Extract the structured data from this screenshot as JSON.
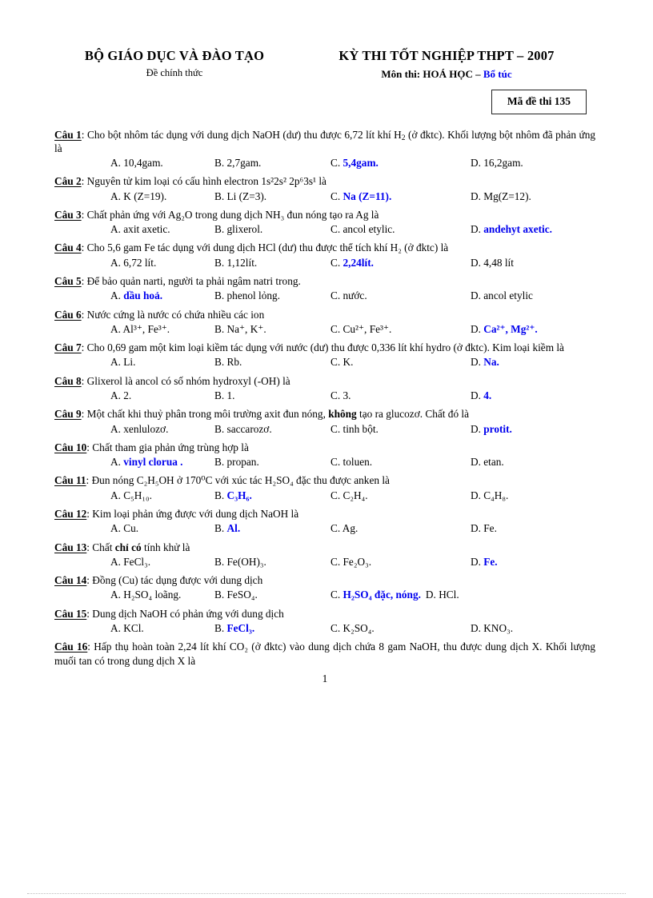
{
  "header": {
    "ministry": "BỘ GIÁO DỤC VÀ ĐÀO TẠO",
    "official": "Đề chính thức",
    "exam_title": "KỲ THI  TỐT NGHIỆP THPT – 2007",
    "subject_label": "Môn thi:  HOÁ HỌC – ",
    "subject_suffix": "Bổ túc",
    "code_box": "Mã đề thi 135",
    "accent_color": "#0000ee"
  },
  "questions": [
    {
      "label": "Câu 1",
      "stem_pre": ": Cho bột nhôm  tác dụng  với  dung  dịch  NaOH (dư) thu được 6,72 lít  khí H",
      "stem_sub": "2",
      "stem_post": " (ở đktc). Khối lượng bột nhôm  đã phản ứng là",
      "layout": "default",
      "options": [
        {
          "letter": "A.",
          "text": "10,4gam.",
          "correct": false
        },
        {
          "letter": "B.",
          "text": "2,7gam.",
          "correct": false
        },
        {
          "letter": "C.",
          "text": "5,4gam.",
          "correct": true
        },
        {
          "letter": "D.",
          "text": "16,2gam.",
          "correct": false
        }
      ]
    },
    {
      "label": "Câu 2",
      "stem_text": ": Nguyên  tử kim  loại  có cấu hình  electron  1s²2s² 2p⁶3s¹ là",
      "layout": "default",
      "options": [
        {
          "letter": "A.",
          "text": "K (Z=19).",
          "correct": false
        },
        {
          "letter": "B.",
          "text": "Li (Z=3).",
          "correct": false
        },
        {
          "letter": "C.",
          "text": "Na (Z=11).",
          "correct": true
        },
        {
          "letter": "D.",
          "text": "Mg(Z=12).",
          "correct": false
        }
      ]
    },
    {
      "label": "Câu 3",
      "stem_text": ": Chất phản ứng với Ag₂O trong  dung  dịch NH₃ đun nóng  tạo ra Ag là",
      "layout": "default",
      "options": [
        {
          "letter": "A.",
          "text": "axit  axetic.",
          "correct": false
        },
        {
          "letter": "B.",
          "text": "glixerol.",
          "correct": false
        },
        {
          "letter": "C.",
          "text": "ancol etylic.",
          "correct": false
        },
        {
          "letter": "D.",
          "text": "andehyt  axetic.",
          "correct": true
        }
      ]
    },
    {
      "label": "Câu 4",
      "stem_text": ": Cho 5,6 gam Fe tác dụng  với  dung  dịch HCl  (dư) thu  được thể  tích  khí H₂ (ở đktc) là",
      "layout": "default",
      "options": [
        {
          "letter": "A.",
          "text": "6,72 lít.",
          "correct": false
        },
        {
          "letter": "B.",
          "text": "1,12lít.",
          "correct": false
        },
        {
          "letter": "C.",
          "text": "2,24lít.",
          "correct": true
        },
        {
          "letter": "D.",
          "text": "4,48 lít",
          "correct": false
        }
      ]
    },
    {
      "label": "Câu 5",
      "stem_text": ": Để bảo quản narti, người  ta phải  ngâm  natri  trong.",
      "layout": "default",
      "options": [
        {
          "letter": "A.",
          "text": "dầu hoả.",
          "correct": true
        },
        {
          "letter": "B.",
          "text": "phenol lỏng.",
          "correct": false
        },
        {
          "letter": "C.",
          "text": "nước.",
          "correct": false
        },
        {
          "letter": "D.",
          "text": "ancol etylic",
          "correct": false
        }
      ]
    },
    {
      "label": "Câu 6",
      "stem_text": ": Nước cứng là nước có chứa nhiều  các ion",
      "layout": "default",
      "options": [
        {
          "letter": "A.",
          "text": "Al³⁺, Fe³⁺.",
          "correct": false
        },
        {
          "letter": "B.",
          "text": "Na⁺, K⁺.",
          "correct": false
        },
        {
          "letter": "C.",
          "text": "Cu²⁺, Fe³⁺.",
          "correct": false
        },
        {
          "letter": "D.",
          "text": "Ca²⁺, Mg²⁺.",
          "correct": true
        }
      ]
    },
    {
      "label": "Câu 7",
      "stem_text": ": Cho 0,69 gam  một kim  loại  kiềm  tác dụng  với  nước  (dư) thu  được 0,336 lít  khí hydro  (ở đktc). Kim  loại kiềm là",
      "layout": "default",
      "options": [
        {
          "letter": "A.",
          "text": "Li.",
          "correct": false
        },
        {
          "letter": "B.",
          "text": "Rb.",
          "correct": false
        },
        {
          "letter": "C.",
          "text": "K.",
          "correct": false
        },
        {
          "letter": "D.",
          "text": "Na.",
          "correct": true
        }
      ]
    },
    {
      "label": "Câu 8",
      "stem_text": ": Glixerol  là ancol có số nhóm  hydroxyl  (-OH) là",
      "layout": "default",
      "options": [
        {
          "letter": "A.",
          "text": "2.",
          "correct": false
        },
        {
          "letter": "B.",
          "text": "1.",
          "correct": false
        },
        {
          "letter": "C.",
          "text": "3.",
          "correct": false
        },
        {
          "letter": "D.",
          "text": "4.",
          "correct": true
        }
      ]
    },
    {
      "label": "Câu 9",
      "stem_text": ": Một chất khi  thuỷ  phân  trong  môi  trường  axit  đun nóng,  không tạo ra glucozơ.  Chất đó là",
      "bold_word": "không",
      "layout": "default",
      "options": [
        {
          "letter": "A.",
          "text": "xenlulozơ.",
          "correct": false
        },
        {
          "letter": "B.",
          "text": "saccarozơ.",
          "correct": false
        },
        {
          "letter": "C.",
          "text": "tinh  bột.",
          "correct": false
        },
        {
          "letter": "D.",
          "text": "protit.",
          "correct": true
        }
      ]
    },
    {
      "label": "Câu 10",
      "stem_text": ": Chất tham  gia  phản ứng trùng  hợp là",
      "layout": "default",
      "options": [
        {
          "letter": "A.",
          "text": "vinyl clorua .",
          "correct": true
        },
        {
          "letter": "B.",
          "text": "propan.",
          "correct": false
        },
        {
          "letter": "C.",
          "text": "toluen.",
          "correct": false
        },
        {
          "letter": "D.",
          "text": "etan.",
          "correct": false
        }
      ]
    },
    {
      "label": "Câu 11",
      "stem_text": ": Đun nóng  C₂H₅OH ở 170⁰C với xúc  tác H₂SO₄ đặc thu được anken là",
      "layout": "default",
      "options": [
        {
          "letter": "A.",
          "text": "C₅H₁₀.",
          "correct": false
        },
        {
          "letter": "B.",
          "text": "C₃H₆.",
          "correct": true
        },
        {
          "letter": "C.",
          "text": "C₂H₄.",
          "correct": false
        },
        {
          "letter": "D.",
          "text": "C₄H₈.",
          "correct": false
        }
      ]
    },
    {
      "label": "Câu 12",
      "stem_text": ": Kim  loại  phản ứng  được với  dung  dịch  NaOH là",
      "layout": "default",
      "options": [
        {
          "letter": "A.",
          "text": "Cu.",
          "correct": false
        },
        {
          "letter": "B.",
          "text": "Al.",
          "correct": true
        },
        {
          "letter": "C.",
          "text": "Ag.",
          "correct": false
        },
        {
          "letter": "D.",
          "text": "Fe.",
          "correct": false
        }
      ]
    },
    {
      "label": "Câu 13",
      "stem_text": ": Chất chỉ có tính  khử là",
      "bold_word": "chỉ có",
      "layout": "default",
      "options": [
        {
          "letter": "A.",
          "text": "FeCl₃.",
          "correct": false
        },
        {
          "letter": "B.",
          "text": "Fe(OH)₃.",
          "correct": false
        },
        {
          "letter": "C.",
          "text": "Fe₂O₃.",
          "correct": false
        },
        {
          "letter": "D.",
          "text": "Fe.",
          "correct": true
        }
      ]
    },
    {
      "label": "Câu 14",
      "stem_text": ": Đồng  (Cu) tác dụng  được với  dung  dịch",
      "layout": "tight",
      "options": [
        {
          "letter": "A.",
          "text": "H₂SO₄ loãng.",
          "correct": false
        },
        {
          "letter": "B.",
          "text": "FeSO₄.",
          "correct": false
        },
        {
          "letter": "C.",
          "text": "H₂SO₄ đặc, nóng.",
          "correct": true
        },
        {
          "letter": "D.",
          "text": "HCl.",
          "correct": false
        }
      ]
    },
    {
      "label": "Câu 15",
      "stem_text": ": Dung  dịch NaOH có phản  ứng với  dung  dịch",
      "layout": "default",
      "options": [
        {
          "letter": "A.",
          "text": "KCl.",
          "correct": false
        },
        {
          "letter": "B.",
          "text": "FeCl₃.",
          "correct": true
        },
        {
          "letter": "C.",
          "text": "K₂SO₄.",
          "correct": false
        },
        {
          "letter": "D.",
          "text": "KNO₃.",
          "correct": false
        }
      ]
    },
    {
      "label": "Câu 16",
      "stem_text": ": Hấp thụ hoàn toàn 2,24 lít khí CO₂ (ở đktc) vào dung  dịch chứa 8 gam  NaOH, thu  được dung  dịch X. Khối lượng muối  tan có trong  dung  dịch  X là",
      "layout": "default",
      "options": []
    }
  ],
  "footer": {
    "page_number": "1"
  }
}
